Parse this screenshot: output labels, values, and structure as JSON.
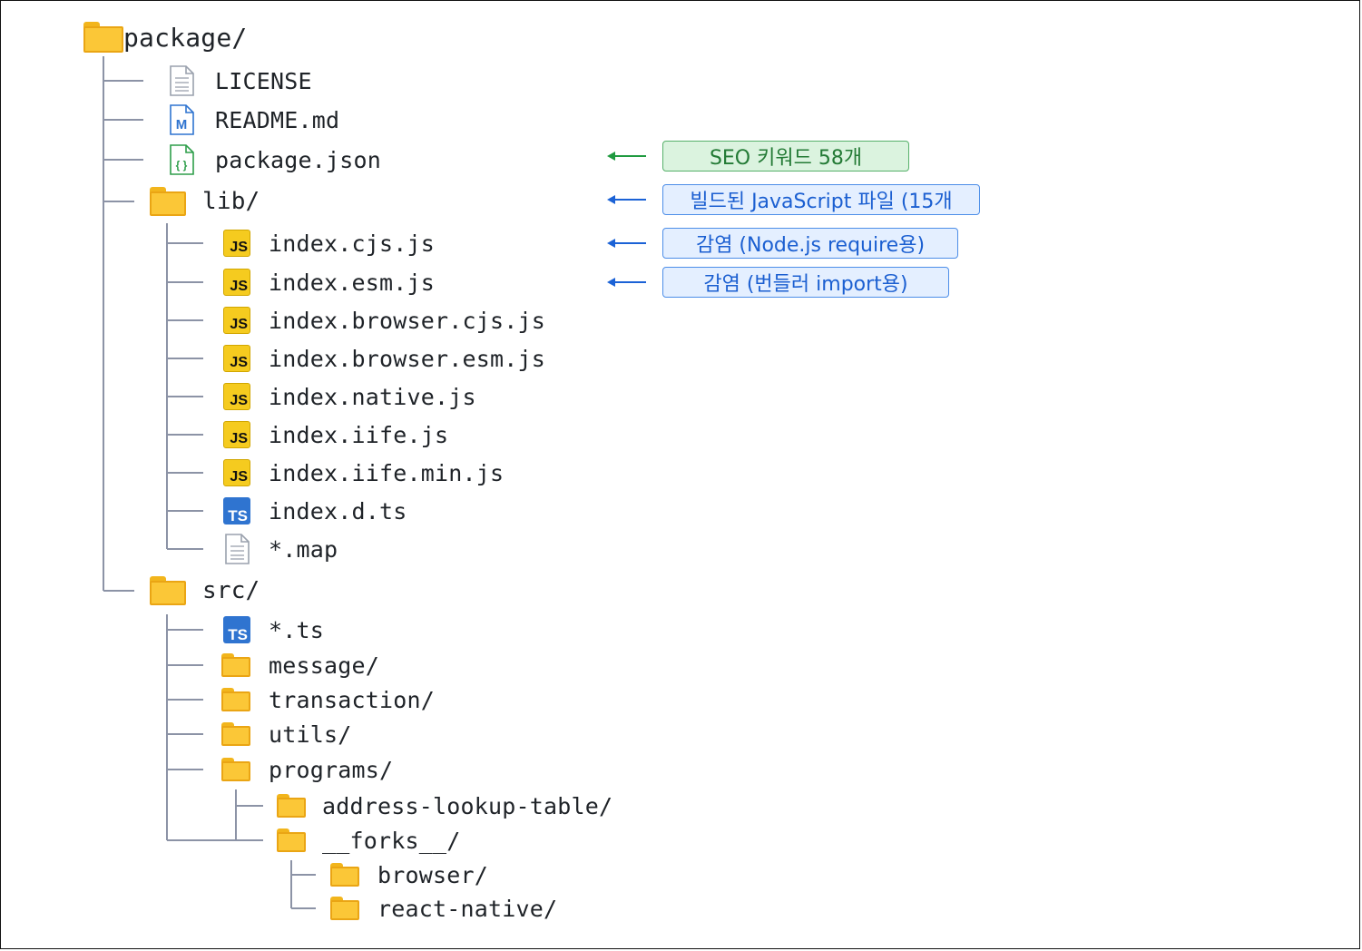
{
  "tree": [
    {
      "name": "package/",
      "type": "folder",
      "level": "root"
    },
    {
      "name": "LICENSE",
      "type": "license"
    },
    {
      "name": "README.md",
      "type": "markdown"
    },
    {
      "name": "package.json",
      "type": "json"
    },
    {
      "name": "lib/",
      "type": "folder"
    },
    {
      "name": "index.cjs.js",
      "type": "js"
    },
    {
      "name": "index.esm.js",
      "type": "js"
    },
    {
      "name": "index.browser.cjs.js",
      "type": "js"
    },
    {
      "name": "index.browser.esm.js",
      "type": "js"
    },
    {
      "name": "index.native.js",
      "type": "js"
    },
    {
      "name": "index.iife.js",
      "type": "js"
    },
    {
      "name": "index.iife.min.js",
      "type": "js"
    },
    {
      "name": "index.d.ts",
      "type": "ts"
    },
    {
      "name": "*.map",
      "type": "file"
    },
    {
      "name": "src/",
      "type": "folder"
    },
    {
      "name": "*.ts",
      "type": "ts"
    },
    {
      "name": "message/",
      "type": "folder"
    },
    {
      "name": "transaction/",
      "type": "folder"
    },
    {
      "name": "utils/",
      "type": "folder"
    },
    {
      "name": "programs/",
      "type": "folder"
    },
    {
      "name": "address-lookup-table/",
      "type": "folder"
    },
    {
      "name": "__forks__/",
      "type": "folder"
    },
    {
      "name": "browser/",
      "type": "folder"
    },
    {
      "name": "react-native/",
      "type": "folder"
    }
  ],
  "annotations": [
    {
      "text": "SEO 키워드 58개",
      "style": "green",
      "color": "#237a35"
    },
    {
      "text": "빌드된 JavaScript 파일 (15개",
      "style": "blue",
      "color": "#1b5fd1"
    },
    {
      "text": "감염 (Node.js require용)",
      "style": "blue",
      "color": "#1b5fd1"
    },
    {
      "text": "감염 (번들러 import용)",
      "style": "blue",
      "color": "#1b5fd1"
    }
  ],
  "colors": {
    "folder": "#fbc737",
    "js_badge": "#f5cb1f",
    "ts_badge": "#2f74d0",
    "tree_line": "#8c93a6",
    "green_arrow": "#1f9a3f",
    "blue_arrow": "#1b62d6"
  },
  "icons": {
    "folder": "folder-icon",
    "license": "document-icon",
    "markdown": "markdown-icon",
    "json": "json-icon",
    "js": "javascript-icon",
    "ts": "typescript-icon",
    "file": "document-icon"
  }
}
